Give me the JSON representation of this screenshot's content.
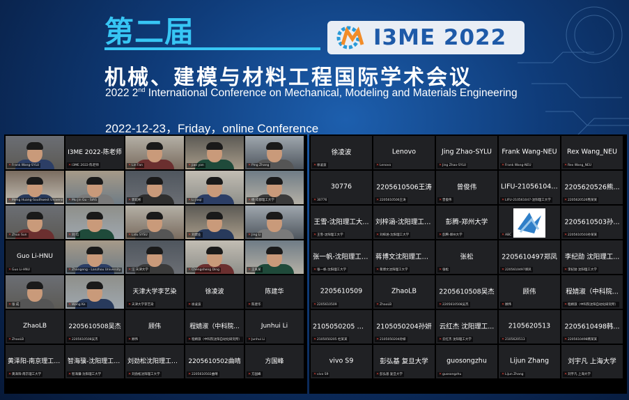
{
  "banner": {
    "title_cn": "第二届",
    "logo_text": "I3ME 2022",
    "subtitle_cn": "机械、建模与材料工程国际学术会议",
    "subtitle_en_pre": "2022 2",
    "subtitle_en_sup": "nd",
    "subtitle_en_post": " International Conference on Mechanical, Modeling and Materials Engineering",
    "date_line": "2022-12-23，Friday，online Conference",
    "colors": {
      "title": "#37c6f4",
      "logo_text": "#1e5aa8",
      "active_border": "#f3d64a"
    }
  },
  "left_gallery": [
    {
      "type": "video",
      "center": "",
      "label": "Frank Wang-SYLU",
      "active": true
    },
    {
      "type": "name",
      "center": "I3ME 2022-陈老师",
      "label": "I3ME 2022-陈老师"
    },
    {
      "type": "video",
      "center": "",
      "label": "Lin Fan"
    },
    {
      "type": "video",
      "center": "",
      "label": "jiao yan"
    },
    {
      "type": "video",
      "center": "",
      "label": "Ping Zhang"
    },
    {
      "type": "video",
      "center": "",
      "label": "Meng Huang-Southwest University"
    },
    {
      "type": "video",
      "center": "",
      "label": "Mu Jin Gu - SIAS"
    },
    {
      "type": "video",
      "center": "",
      "label": "郭延彬"
    },
    {
      "type": "video",
      "center": "",
      "label": "Li Jiaqi"
    },
    {
      "type": "video",
      "center": "",
      "label": "杨 成都理工大学"
    },
    {
      "type": "video",
      "center": "",
      "label": "Zhuo Sun"
    },
    {
      "type": "video",
      "center": "",
      "label": "刘 信"
    },
    {
      "type": "video",
      "center": "",
      "label": "Lidu SYSU"
    },
    {
      "type": "video",
      "center": "",
      "label": "刘建业"
    },
    {
      "type": "video",
      "center": "",
      "label": "Jing Li"
    },
    {
      "type": "name",
      "center": "Guo Li-HNU",
      "label": "Guo Li-HNU"
    },
    {
      "type": "video",
      "center": "",
      "label": "Zhangeng - Lanzhou University"
    },
    {
      "type": "video",
      "center": "",
      "label": "汪 天津大学"
    },
    {
      "type": "video",
      "center": "",
      "label": "Chengsheng Ding"
    },
    {
      "type": "video",
      "center": "",
      "label": "王某某"
    },
    {
      "type": "video",
      "center": "",
      "label": "张 成"
    },
    {
      "type": "video",
      "center": "",
      "label": "Wang Ke"
    },
    {
      "type": "name",
      "center": "天津大学李艺染",
      "label": "天津大学李艺染"
    },
    {
      "type": "name",
      "center": "徐凌波",
      "label": "徐凌波"
    },
    {
      "type": "name",
      "center": "陈建华",
      "label": "陈建华"
    },
    {
      "type": "name",
      "center": "ZhaoLB",
      "label": "ZhaoLB"
    },
    {
      "type": "name",
      "center": "2205610508吴杰",
      "label": "2205610508吴杰"
    },
    {
      "type": "name",
      "center": "顾伟",
      "label": "顾伟"
    },
    {
      "type": "name",
      "center": "程婧淑（中科院...",
      "label": "程婧淑（中科院沈阳自动化研究所）"
    },
    {
      "type": "name",
      "center": "Junhui Li",
      "label": "Junhui Li"
    },
    {
      "type": "name",
      "center": "黄泽阳-南京理工大学",
      "label": "黄泽阳-南京理工大学"
    },
    {
      "type": "name",
      "center": "智海骥-沈阳理工大学",
      "label": "智海骥-沈阳理工大学"
    },
    {
      "type": "name",
      "center": "刘劲松沈阳理工大学",
      "label": "刘劲松沈阳理工大学"
    },
    {
      "type": "name",
      "center": "2205610502曲晴",
      "label": "2205610502曲晴"
    },
    {
      "type": "name",
      "center": "方国峰",
      "label": "方国峰"
    }
  ],
  "right_gallery": [
    {
      "center": "徐凌波",
      "label": "徐凌波"
    },
    {
      "center": "Lenovo",
      "label": "Lenovo"
    },
    {
      "center": "Jing Zhao-SYLU",
      "label": "Jing Zhao-SYLU"
    },
    {
      "center": "Frank Wang-NEU",
      "label": "Frank Wang-NEU"
    },
    {
      "center": "Rex Wang_NEU",
      "label": "Rex Wang_NEU"
    },
    {
      "center": "30776",
      "label": "30776"
    },
    {
      "center": "2205610506王涛",
      "label": "2205610506王涛"
    },
    {
      "center": "曾俊伟",
      "label": "曾俊伟"
    },
    {
      "center": "LIFU-210561047...",
      "label": "LIFU-210561047-沈阳理工大学"
    },
    {
      "center": "2205620526熊...",
      "label": "2205620526熊某某"
    },
    {
      "center": "王雪-沈阳理工大...",
      "label": "王雪-沈阳理工大学"
    },
    {
      "center": "刘梓涵-沈阳理工大学",
      "label": "刘梓涵-沈阳理工大学"
    },
    {
      "center": "彭腾-郑州大学",
      "label": "彭腾-郑州大学"
    },
    {
      "center": "",
      "label": "ABC",
      "image": true
    },
    {
      "center": "2205610503孙...",
      "label": "2205610503孙某某"
    },
    {
      "center": "张一帆-沈阳理工大...",
      "label": "张一帆-沈阳理工大学"
    },
    {
      "center": "蒋博文沈阳理工大学",
      "label": "蒋博文沈阳理工大学"
    },
    {
      "center": "张松",
      "label": "张松"
    },
    {
      "center": "2205610497郑凤",
      "label": "2205610497郑凤"
    },
    {
      "center": "李纪勋 沈阳理工...",
      "label": "李纪勋 沈阳理工大学"
    },
    {
      "center": "2205610509",
      "label": "2205610509"
    },
    {
      "center": "ZhaoLB",
      "label": "ZhaoLB"
    },
    {
      "center": "2205610508吴杰",
      "label": "2205610508吴杰"
    },
    {
      "center": "顾伟",
      "label": "顾伟"
    },
    {
      "center": "程婧淑（中科院...",
      "label": "程婧淑（中科院沈阳自动化研究所）"
    },
    {
      "center": "2105050205 杜...",
      "label": "2105050205 杜某某"
    },
    {
      "center": "2105050204孙妍",
      "label": "2105050204孙妍"
    },
    {
      "center": "云红杰 沈阳理工...",
      "label": "云红杰 沈阳理工大学"
    },
    {
      "center": "2105620513",
      "label": "2105620513"
    },
    {
      "center": "2205610498韩...",
      "label": "2205610498韩某某"
    },
    {
      "center": "vivo S9",
      "label": "vivo S9"
    },
    {
      "center": "彭弘基 复旦大学",
      "label": "彭弘基 复旦大学"
    },
    {
      "center": "guosongzhu",
      "label": "guosongzhu"
    },
    {
      "center": "Lijun Zhang",
      "label": "Lijun Zhang"
    },
    {
      "center": "刘宇凡 上海大学",
      "label": "刘宇凡 上海大学"
    }
  ]
}
